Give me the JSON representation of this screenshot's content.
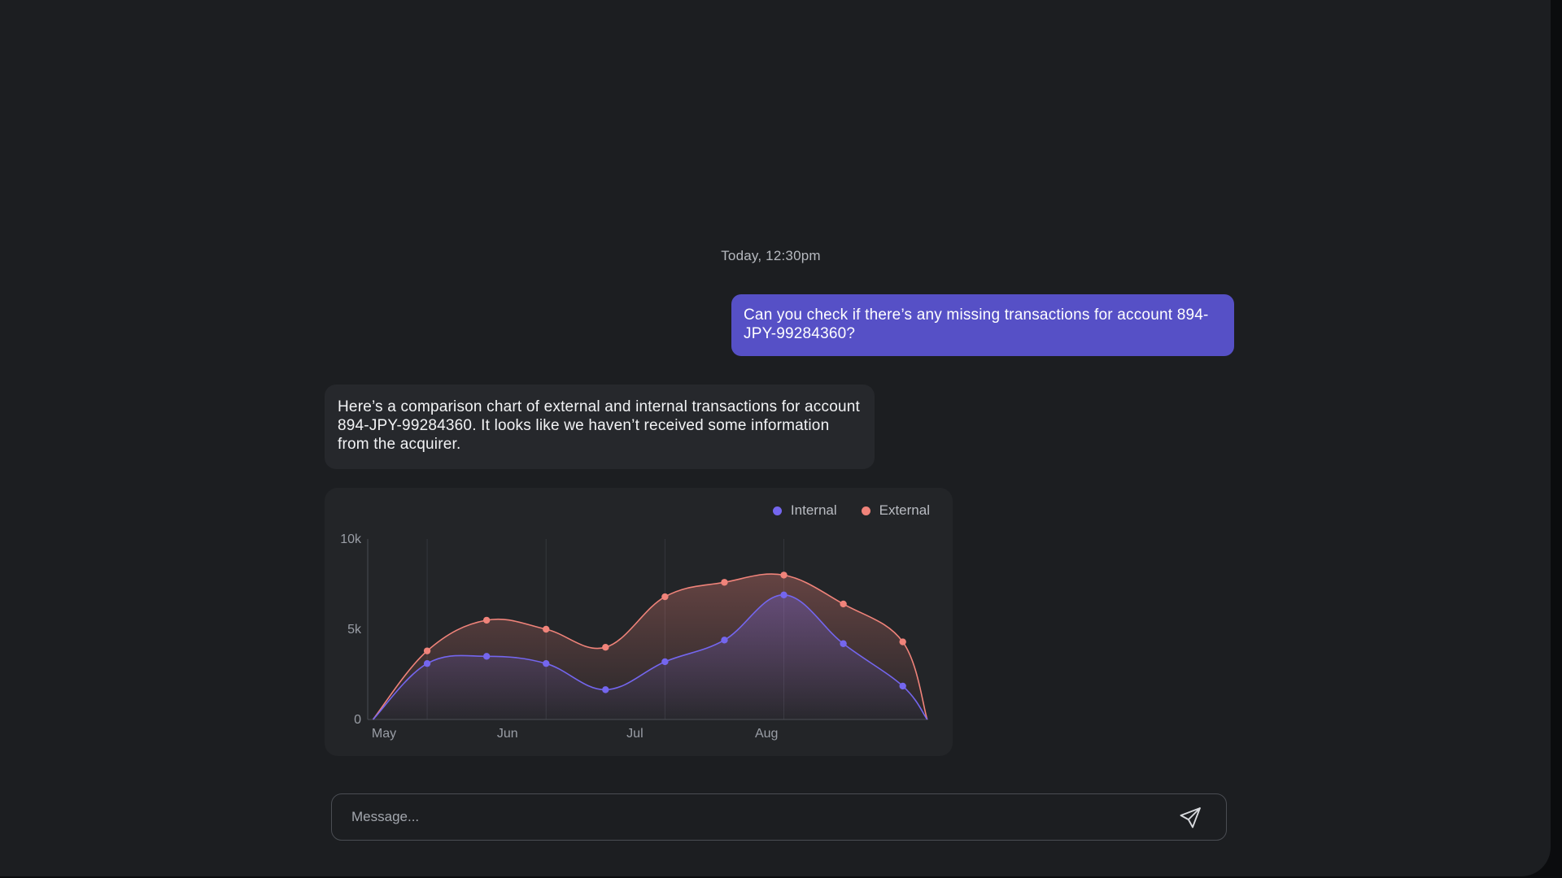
{
  "conversation": {
    "timestamp": "Today, 12:30pm",
    "user_message": "Can you check if there’s any missing transactions for account 894-JPY-99284360?",
    "assistant_message": "Here’s a comparison chart of external and internal transactions for account 894-JPY-99284360. It looks like we haven’t received some information from the acquirer."
  },
  "composer": {
    "placeholder": "Message...",
    "send_icon": "paper-plane-icon"
  },
  "colors": {
    "internal": "#7466ee",
    "external": "#f0837a",
    "user_bubble": "#5650c6"
  },
  "chart_data": {
    "type": "area",
    "x": [
      "2024-05-15",
      "2024-05-29",
      "2024-06-12",
      "2024-06-26",
      "2024-07-10",
      "2024-07-24",
      "2024-08-07",
      "2024-08-21",
      "2024-09-04"
    ],
    "x_tick_labels": [
      "May",
      "Jun",
      "Jul",
      "Aug"
    ],
    "y_ticks": [
      {
        "value": 0,
        "label": "0"
      },
      {
        "value": 5000,
        "label": "5k"
      },
      {
        "value": 10000,
        "label": "10k"
      }
    ],
    "ylim": [
      0,
      10000
    ],
    "series": [
      {
        "name": "Internal",
        "color": "#7466ee",
        "values": [
          3100,
          3500,
          3100,
          1650,
          3200,
          4400,
          6900,
          4200,
          1850
        ]
      },
      {
        "name": "External",
        "color": "#f0837a",
        "values": [
          3800,
          5500,
          5000,
          4000,
          6800,
          7600,
          8000,
          6400,
          4300
        ]
      }
    ],
    "grid": "vertical",
    "legend": "top-right"
  }
}
